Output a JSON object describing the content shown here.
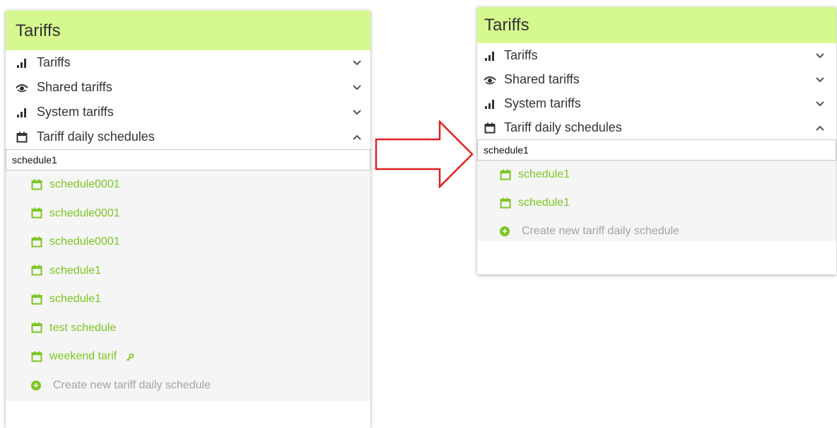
{
  "left": {
    "title": "Tariffs",
    "menu": [
      {
        "label": "Tariffs",
        "icon": "bar-chart-icon",
        "chevron": "⌄"
      },
      {
        "label": "Shared tariffs",
        "icon": "eye-icon",
        "chevron": "⌄"
      },
      {
        "label": "System tariffs",
        "icon": "bar-chart-icon",
        "chevron": "⌄"
      },
      {
        "label": "Tariff daily schedules",
        "icon": "calendar-icon",
        "chevron": "⌃"
      }
    ],
    "search_value": "schedule1",
    "results": [
      "schedule0001",
      "schedule0001",
      "schedule0001",
      "schedule1",
      "schedule1",
      "test schedule",
      "weekend tarif"
    ],
    "create_label": "Create new tariff daily schedule"
  },
  "right": {
    "title": "Tariffs",
    "menu": [
      {
        "label": "Tariffs",
        "icon": "bar-chart-icon",
        "chevron": "⌄"
      },
      {
        "label": "Shared tariffs",
        "icon": "eye-icon",
        "chevron": "⌄"
      },
      {
        "label": "System tariffs",
        "icon": "bar-chart-icon",
        "chevron": "⌄"
      },
      {
        "label": "Tariff daily schedules",
        "icon": "calendar-icon",
        "chevron": "⌃"
      }
    ],
    "search_value": "schedule1",
    "results": [
      "schedule1",
      "schedule1"
    ],
    "create_label": "Create new tariff daily schedule"
  },
  "colors": {
    "header_bg": "#d5f98f",
    "accent_green": "#7cc623",
    "arrow_red": "#e02020",
    "muted_text": "#a3a3a3"
  }
}
